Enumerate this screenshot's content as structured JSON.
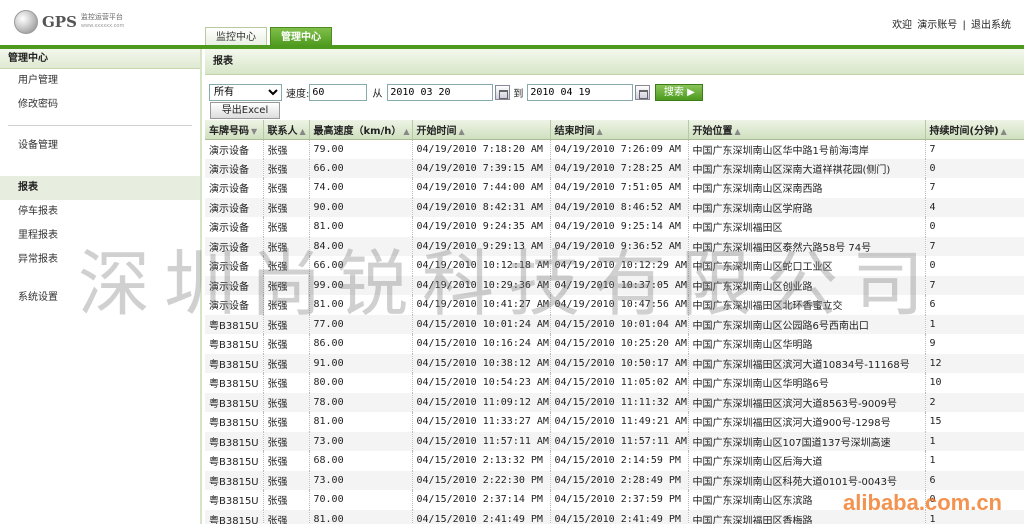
{
  "header": {
    "logo_text": "GPS",
    "logo_sub": "监控运营平台",
    "logo_url": "www.xxxxxx.com",
    "welcome": "欢迎",
    "account": "演示账号",
    "separator": "|",
    "logout": "退出系统"
  },
  "tabs": [
    {
      "label": "监控中心",
      "active": false
    },
    {
      "label": "管理中心",
      "active": true
    }
  ],
  "sidebar": {
    "title": "管理中心",
    "items": [
      "用户管理",
      "修改密码"
    ],
    "device_mgmt": "设备管理",
    "reports_title": "报表",
    "report_items": [
      "停车报表",
      "里程报表",
      "异常报表"
    ],
    "settings": "系统设置"
  },
  "main": {
    "title": "报表",
    "filter": {
      "select_value": "所有",
      "speed_label": "速度:",
      "speed_value": "60",
      "from_label": "从",
      "date_from": "2010 03 20",
      "to_label": "到",
      "date_to": "2010 04 19",
      "query_label": "搜索",
      "export_label": "导出Excel"
    },
    "columns": [
      "车牌号码",
      "联系人",
      "最高速度（km/h）",
      "开始时间",
      "结束时间",
      "开始位置",
      "持续时间(分钟)"
    ],
    "rows": [
      [
        "演示设备",
        "张强",
        "79.00",
        "04/19/2010 7:18:20 AM",
        "04/19/2010 7:26:09 AM",
        "中国广东深圳南山区华中路1号前海湾岸",
        "7"
      ],
      [
        "演示设备",
        "张强",
        "66.00",
        "04/19/2010 7:39:15 AM",
        "04/19/2010 7:28:25 AM",
        "中国广东深圳南山区深南大道祥祺花园(侧门)",
        "0"
      ],
      [
        "演示设备",
        "张强",
        "74.00",
        "04/19/2010 7:44:00 AM",
        "04/19/2010 7:51:05 AM",
        "中国广东深圳南山区深南西路",
        "7"
      ],
      [
        "演示设备",
        "张强",
        "90.00",
        "04/19/2010 8:42:31 AM",
        "04/19/2010 8:46:52 AM",
        "中国广东深圳南山区学府路",
        "4"
      ],
      [
        "演示设备",
        "张强",
        "81.00",
        "04/19/2010 9:24:35 AM",
        "04/19/2010 9:25:14 AM",
        "中国广东深圳福田区",
        "0"
      ],
      [
        "演示设备",
        "张强",
        "84.00",
        "04/19/2010 9:29:13 AM",
        "04/19/2010 9:36:52 AM",
        "中国广东深圳福田区泰然六路58号 74号",
        "7"
      ],
      [
        "演示设备",
        "张强",
        "66.00",
        "04/19/2010 10:12:18 AM",
        "04/19/2010 10:12:29 AM",
        "中国广东深圳南山区蛇口工业区",
        "0"
      ],
      [
        "演示设备",
        "张强",
        "99.00",
        "04/19/2010 10:29:36 AM",
        "04/19/2010 10:37:05 AM",
        "中国广东深圳南山区创业路",
        "7"
      ],
      [
        "演示设备",
        "张强",
        "81.00",
        "04/19/2010 10:41:27 AM",
        "04/19/2010 10:47:56 AM",
        "中国广东深圳福田区北环香蜜立交",
        "6"
      ],
      [
        "粤B3815U",
        "张强",
        "77.00",
        "04/15/2010 10:01:24 AM",
        "04/15/2010 10:01:04 AM",
        "中国广东深圳南山区公园路6号西南出口",
        "1"
      ],
      [
        "粤B3815U",
        "张强",
        "86.00",
        "04/15/2010 10:16:24 AM",
        "04/15/2010 10:25:20 AM",
        "中国广东深圳南山区华明路",
        "9"
      ],
      [
        "粤B3815U",
        "张强",
        "91.00",
        "04/15/2010 10:38:12 AM",
        "04/15/2010 10:50:17 AM",
        "中国广东深圳福田区滨河大道10834号-11168号",
        "12"
      ],
      [
        "粤B3815U",
        "张强",
        "80.00",
        "04/15/2010 10:54:23 AM",
        "04/15/2010 11:05:02 AM",
        "中国广东深圳南山区华明路6号",
        "10"
      ],
      [
        "粤B3815U",
        "张强",
        "78.00",
        "04/15/2010 11:09:12 AM",
        "04/15/2010 11:11:32 AM",
        "中国广东深圳福田区滨河大道8563号-9009号",
        "2"
      ],
      [
        "粤B3815U",
        "张强",
        "81.00",
        "04/15/2010 11:33:27 AM",
        "04/15/2010 11:49:21 AM",
        "中国广东深圳福田区滨河大道900号-1298号",
        "15"
      ],
      [
        "粤B3815U",
        "张强",
        "73.00",
        "04/15/2010 11:57:11 AM",
        "04/15/2010 11:57:11 AM",
        "中国广东深圳南山区107国道137号深圳高速",
        "1"
      ],
      [
        "粤B3815U",
        "张强",
        "68.00",
        "04/15/2010 2:13:32 PM",
        "04/15/2010 2:14:59 PM",
        "中国广东深圳南山区后海大道",
        "1"
      ],
      [
        "粤B3815U",
        "张强",
        "73.00",
        "04/15/2010 2:22:30 PM",
        "04/15/2010 2:28:49 PM",
        "中国广东深圳南山区科苑大道0101号-0043号",
        "6"
      ],
      [
        "粤B3815U",
        "张强",
        "70.00",
        "04/15/2010 2:37:14 PM",
        "04/15/2010 2:37:59 PM",
        "中国广东深圳南山区东滨路",
        "0"
      ],
      [
        "粤B3815U",
        "张强",
        "81.00",
        "04/15/2010 2:41:49 PM",
        "04/15/2010 2:41:49 PM",
        "中国广东深圳福田区香梅路",
        "1"
      ]
    ]
  },
  "watermark": "深圳尚锐科技有限公司",
  "alibaba_mark": "alibaba.com.cn"
}
